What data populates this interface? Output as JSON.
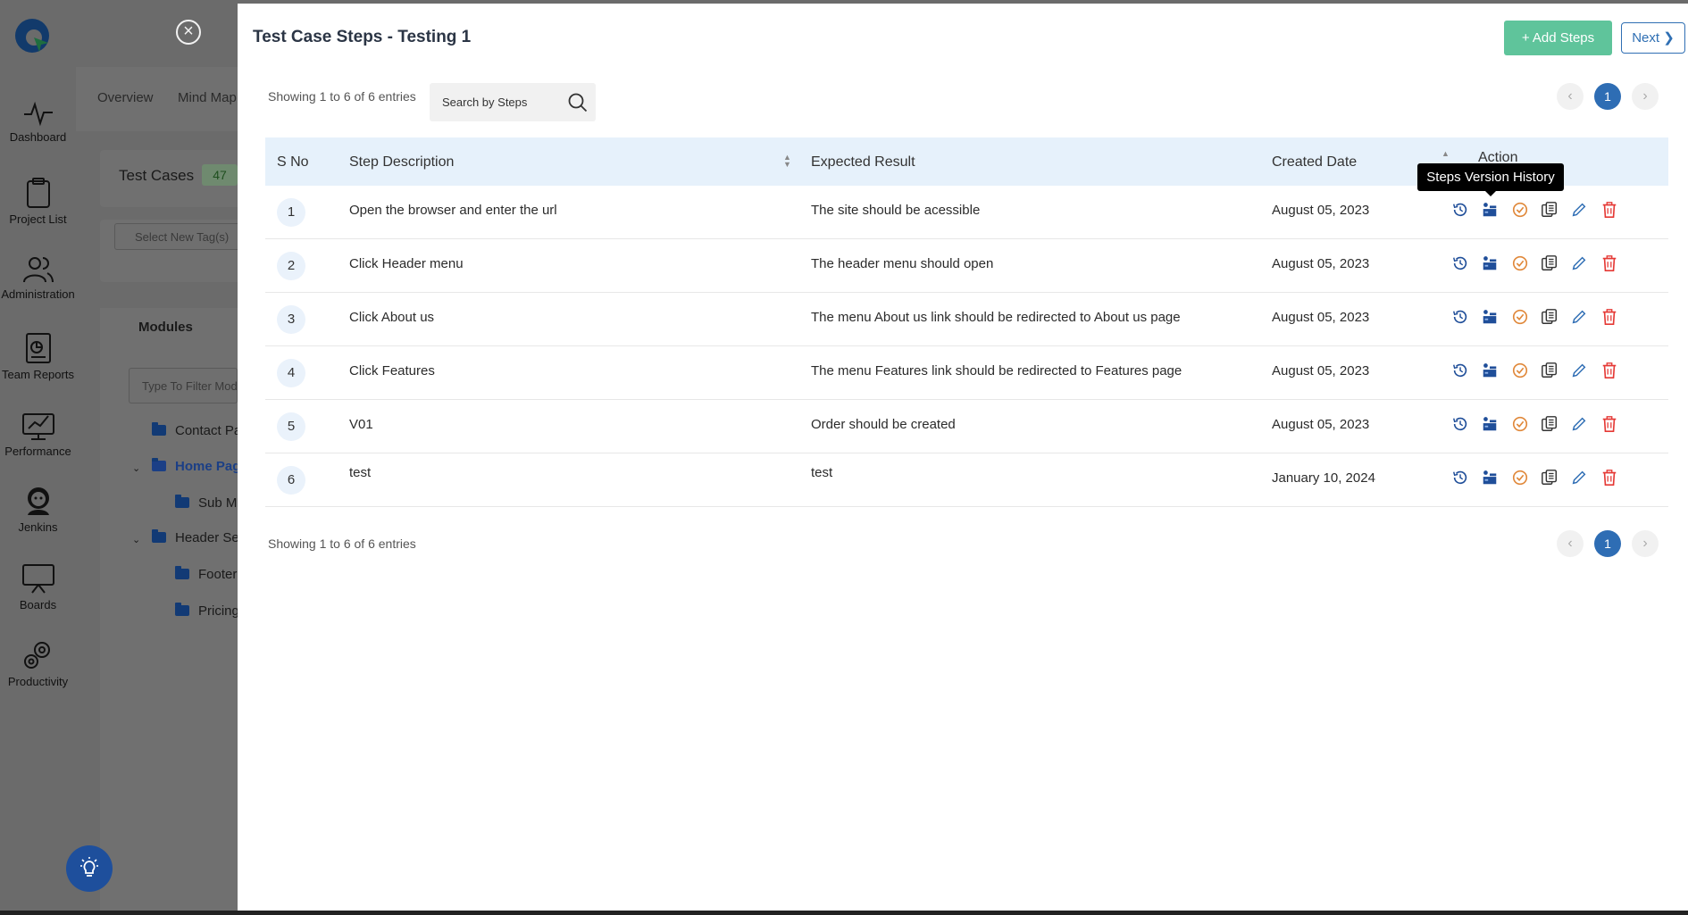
{
  "sidebar": {
    "items": [
      {
        "label": "Dashboard",
        "icon": "pulse-icon"
      },
      {
        "label": "Project List",
        "icon": "clipboard-icon"
      },
      {
        "label": "Administration",
        "icon": "users-icon"
      },
      {
        "label": "Team Reports",
        "icon": "report-icon"
      },
      {
        "label": "Performance",
        "icon": "monitor-chart-icon"
      },
      {
        "label": "Jenkins",
        "icon": "jenkins-icon"
      },
      {
        "label": "Boards",
        "icon": "board-icon"
      },
      {
        "label": "Productivity",
        "icon": "gears-icon"
      }
    ]
  },
  "background": {
    "tabs": [
      "Overview",
      "Mind Map"
    ],
    "test_cases_label": "Test Cases",
    "test_cases_count": "47",
    "tag_placeholder": "Select New Tag(s)",
    "modules_title": "Modules",
    "modules_filter_placeholder": "Type To Filter Modules",
    "tree": [
      "Contact Pa",
      "Home Pag",
      "Sub M",
      "Header Se",
      "Footer",
      "Pricing"
    ]
  },
  "modal": {
    "title": "Test Case Steps - Testing 1",
    "add_steps_label": "+ Add Steps",
    "next_label": "Next",
    "showing_text": "Showing 1 to 6 of 6 entries",
    "search_placeholder": "Search by Steps",
    "current_page": "1",
    "columns": {
      "sno": "S No",
      "description": "Step Description",
      "expected": "Expected Result",
      "created": "Created Date",
      "action": "Action"
    },
    "tooltip": "Steps Version History",
    "rows": [
      {
        "sno": "1",
        "description": "Open the browser and enter the url",
        "expected": "The site should be acessible",
        "date": "August 05, 2023"
      },
      {
        "sno": "2",
        "description": "Click Header menu",
        "expected": "The header menu should open",
        "date": "August 05, 2023"
      },
      {
        "sno": "3",
        "description": "Click About us",
        "expected": "The menu About us link should be redirected to About us page",
        "date": "August 05, 2023"
      },
      {
        "sno": "4",
        "description": "Click Features",
        "expected": "The menu Features link should be redirected to Features page",
        "date": "August 05, 2023"
      },
      {
        "sno": "5",
        "description": "V01",
        "expected": "Order should be created",
        "date": "August 05, 2023"
      },
      {
        "sno": "6",
        "description": "test",
        "expected": "test",
        "date": "January 10, 2024"
      }
    ],
    "action_icons": [
      "history-icon",
      "steps-icon",
      "check-circle-icon",
      "copy-icon",
      "edit-icon",
      "delete-icon"
    ]
  },
  "colors": {
    "accent_blue": "#2e6db4",
    "add_button_green": "#5fc49b",
    "delete_red": "#e53935",
    "approve_orange": "#e0883a",
    "header_row_bg": "#e6f1fb"
  }
}
